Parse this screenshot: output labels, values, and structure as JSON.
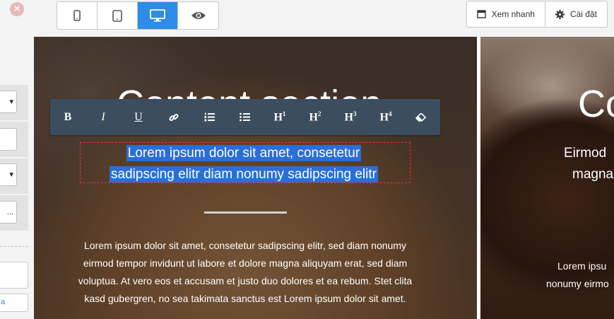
{
  "sidebar": {
    "close_glyph": "×",
    "fields": [
      "▾",
      "",
      "▾",
      "..."
    ],
    "link_text": "a"
  },
  "toolbar": {
    "devices": [
      {
        "name": "mobile-icon",
        "active": false
      },
      {
        "name": "tablet-icon",
        "active": false
      },
      {
        "name": "desktop-icon",
        "active": true
      },
      {
        "name": "eye-icon",
        "active": false
      }
    ],
    "preview_label": "Xem nhanh",
    "settings_label": "Cài đặt"
  },
  "format_toolbar": {
    "bold": "B",
    "italic": "I",
    "underline": "U",
    "h1": "H",
    "h1_sup": "1",
    "h2": "H",
    "h2_sup": "2",
    "h3": "H",
    "h3_sup": "3",
    "h4": "H",
    "h4_sup": "4"
  },
  "panel1": {
    "title": "Content section",
    "subtitle_line1": "Lorem ipsum dolor sit amet, consetetur",
    "subtitle_line2": "sadipscing elitr diam nonumy sadipscing elitr",
    "body": "Lorem ipsum dolor sit amet, consetetur sadipscing elitr, sed diam nonumy eirmod tempor invidunt ut labore et dolore magna aliquyam erat, sed diam voluptua. At vero eos et accusam et justo duo dolores et ea rebum. Stet clita kasd gubergren, no sea takimata sanctus est Lorem ipsum dolor sit amet."
  },
  "panel2": {
    "title": "Co",
    "subtitle_line1": "Eirmod",
    "subtitle_line2": "magna",
    "body_line1": "Lorem ipsu",
    "body_line2": "nonumy eirmo"
  },
  "colors": {
    "accent": "#2d8ce6",
    "highlight": "#2b6ed8",
    "toolbar": "#3c4d5f"
  }
}
